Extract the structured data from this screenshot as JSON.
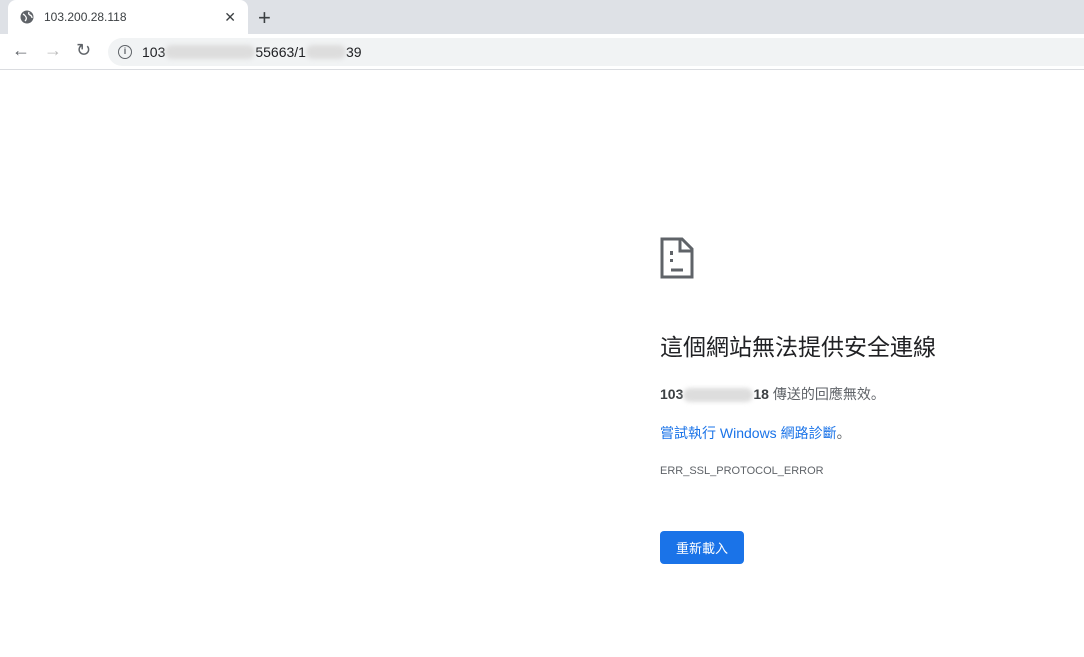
{
  "tab": {
    "title": "103.200.28.118"
  },
  "omnibox": {
    "part1": "103",
    "part2": "55663/1",
    "part3": "39"
  },
  "error": {
    "title": "這個網站無法提供安全連線",
    "host_start": "103",
    "host_end": "18",
    "desc_suffix": " 傳送的回應無效。",
    "link": "嘗試執行 Windows 網路診斷",
    "link_suffix": "。",
    "code": "ERR_SSL_PROTOCOL_ERROR",
    "reload": "重新載入"
  },
  "colors": {
    "accent": "#1a73e8"
  }
}
